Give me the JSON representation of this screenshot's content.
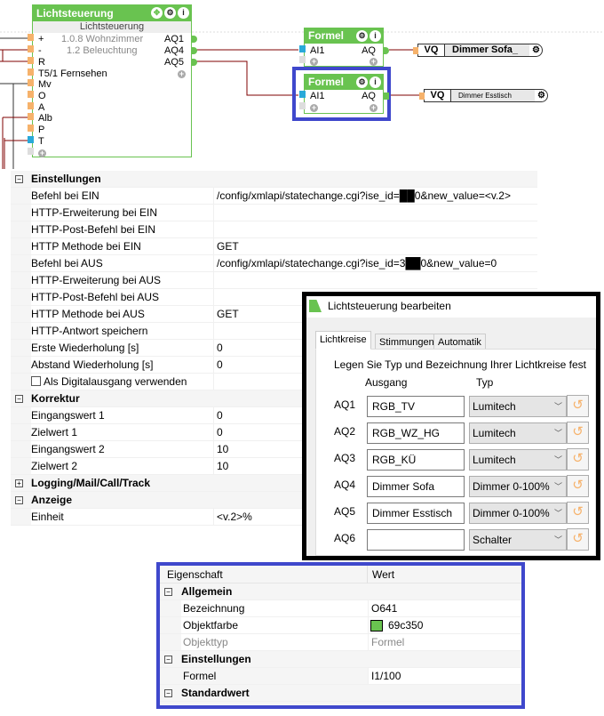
{
  "canvas": {
    "main_block": {
      "title": "Lichtsteuerung",
      "subtitle": "Lichtsteuerung",
      "inputs": [
        "+",
        "-",
        "R",
        "T5/1 Fernsehen",
        "Mv",
        "O",
        "A",
        "Alb",
        "P",
        "T"
      ],
      "info_lines": [
        "1.0.8 Wohnzimmer",
        "1.2 Beleuchtung"
      ],
      "outputs": [
        "AQ1",
        "AQ4",
        "AQ5"
      ]
    },
    "formula_blocks": [
      {
        "title": "Formel",
        "input": "AI1",
        "output": "AQ"
      },
      {
        "title": "Formel",
        "input": "AI1",
        "output": "AQ"
      }
    ],
    "vq_blocks": [
      {
        "label": "VQ",
        "name": "Dimmer Sofa_"
      },
      {
        "label": "VQ",
        "name": "Dimmer Esstisch"
      }
    ],
    "colors": {
      "block_green": "#69c350",
      "wire": "#7f0000",
      "highlight": "#3f48cc"
    }
  },
  "properties": {
    "sections": [
      {
        "title": "Einstellungen",
        "rows": [
          {
            "k": "Befehl bei EIN",
            "v": "/config/xmlapi/statechange.cgi?ise_id=██0&new_value=<v.2>"
          },
          {
            "k": "HTTP-Erweiterung bei EIN",
            "v": ""
          },
          {
            "k": "HTTP-Post-Befehl bei EIN",
            "v": ""
          },
          {
            "k": "HTTP Methode bei EIN",
            "v": "GET"
          },
          {
            "k": "Befehl bei AUS",
            "v": "/config/xmlapi/statechange.cgi?ise_id=3██0&new_value=0"
          },
          {
            "k": "HTTP-Erweiterung bei AUS",
            "v": ""
          },
          {
            "k": "HTTP-Post-Befehl bei AUS",
            "v": ""
          },
          {
            "k": "HTTP Methode bei AUS",
            "v": "GET"
          },
          {
            "k": "HTTP-Antwort speichern",
            "v": ""
          },
          {
            "k": "Erste Wiederholung [s]",
            "v": "0"
          },
          {
            "k": "Abstand Wiederholung [s]",
            "v": "0"
          }
        ],
        "checkbox": "Als Digitalausgang verwenden"
      },
      {
        "title": "Korrektur",
        "rows": [
          {
            "k": "Eingangswert 1",
            "v": "0"
          },
          {
            "k": "Zielwert 1",
            "v": "0"
          },
          {
            "k": "Eingangswert 2",
            "v": "10"
          },
          {
            "k": "Zielwert 2",
            "v": "10"
          }
        ]
      },
      {
        "title": "Logging/Mail/Call/Track",
        "rows": [],
        "collapsed": true
      },
      {
        "title": "Anzeige",
        "rows": [
          {
            "k": "Einheit",
            "v": "<v.2>%"
          }
        ]
      }
    ]
  },
  "dialog": {
    "title": "Lichtsteuerung bearbeiten",
    "tabs": [
      "Lichtkreise",
      "Stimmungen",
      "Automatik"
    ],
    "instruction": "Legen Sie Typ und Bezeichnung Ihrer Lichtkreise fest",
    "col_output": "Ausgang",
    "col_type": "Typ",
    "rows": [
      {
        "id": "AQ1",
        "name": "RGB_TV",
        "type": "Lumitech"
      },
      {
        "id": "AQ2",
        "name": "RGB_WZ_HG",
        "type": "Lumitech"
      },
      {
        "id": "AQ3",
        "name": "RGB_KÜ",
        "type": "Lumitech"
      },
      {
        "id": "AQ4",
        "name": "Dimmer Sofa",
        "type": "Dimmer 0-100%"
      },
      {
        "id": "AQ5",
        "name": "Dimmer Esstisch",
        "type": "Dimmer 0-100%"
      },
      {
        "id": "AQ6",
        "name": "",
        "type": "Schalter"
      }
    ]
  },
  "formula_props": {
    "header": {
      "k": "Eigenschaft",
      "v": "Wert"
    },
    "allgemein": "Allgemein",
    "bez": {
      "k": "Bezeichnung",
      "v": "O641"
    },
    "farbe": {
      "k": "Objektfarbe",
      "v": "69c350",
      "color": "#69c350"
    },
    "typ": {
      "k": "Objekttyp",
      "v": "Formel"
    },
    "einstellungen": "Einstellungen",
    "formel": {
      "k": "Formel",
      "v": "I1/100"
    },
    "standard": "Standardwert"
  }
}
